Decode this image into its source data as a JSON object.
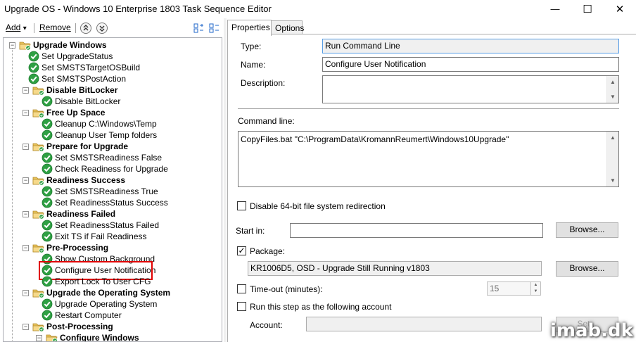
{
  "window": {
    "title": "Upgrade OS - Windows 10 Enterprise 1803 Task Sequence Editor",
    "minimize_glyph": "—",
    "maximize_glyph": "☐",
    "close_glyph": "✕"
  },
  "toolbar": {
    "add_label": "Add",
    "add_arrow": "▾",
    "remove_label": "Remove",
    "move_up_glyph": "⌃",
    "move_down_glyph": "⌄"
  },
  "tree": {
    "nodes": [
      {
        "label": "Upgrade Windows",
        "kind": "group",
        "level": 0
      },
      {
        "label": "Set UpgradeStatus",
        "kind": "step",
        "level": 1
      },
      {
        "label": "Set SMSTSTargetOSBuild",
        "kind": "step",
        "level": 1
      },
      {
        "label": "Set SMSTSPostAction",
        "kind": "step",
        "level": 1
      },
      {
        "label": "Disable BitLocker",
        "kind": "group",
        "level": 1
      },
      {
        "label": "Disable BitLocker",
        "kind": "step",
        "level": 2
      },
      {
        "label": "Free Up Space",
        "kind": "group",
        "level": 1
      },
      {
        "label": "Cleanup C:\\Windows\\Temp",
        "kind": "step",
        "level": 2
      },
      {
        "label": "Cleanup User Temp folders",
        "kind": "step",
        "level": 2
      },
      {
        "label": "Prepare for Upgrade",
        "kind": "group",
        "level": 1
      },
      {
        "label": "Set SMSTSReadiness False",
        "kind": "step",
        "level": 2
      },
      {
        "label": "Check Readiness for Upgrade",
        "kind": "step",
        "level": 2
      },
      {
        "label": "Readiness Success",
        "kind": "group",
        "level": 1
      },
      {
        "label": "Set SMSTSReadiness True",
        "kind": "step",
        "level": 2
      },
      {
        "label": "Set ReadinessStatus Success",
        "kind": "step",
        "level": 2
      },
      {
        "label": "Readiness Failed",
        "kind": "group",
        "level": 1
      },
      {
        "label": "Set ReadinessStatus Failed",
        "kind": "step",
        "level": 2
      },
      {
        "label": "Exit TS if Fail Readiness",
        "kind": "step",
        "level": 2
      },
      {
        "label": "Pre-Processing",
        "kind": "group",
        "level": 1
      },
      {
        "label": "Show Custom Background",
        "kind": "step",
        "level": 2
      },
      {
        "label": "Configure User Notification",
        "kind": "step",
        "level": 2,
        "selected": true
      },
      {
        "label": "Export Lock To User CFG",
        "kind": "step",
        "level": 2
      },
      {
        "label": "Upgrade the Operating System",
        "kind": "group",
        "level": 1
      },
      {
        "label": "Upgrade Operating System",
        "kind": "step",
        "level": 2
      },
      {
        "label": "Restart Computer",
        "kind": "step",
        "level": 2
      },
      {
        "label": "Post-Processing",
        "kind": "group",
        "level": 1
      },
      {
        "label": "Configure Windows",
        "kind": "group",
        "level": 2
      }
    ],
    "expander_glyph": "−"
  },
  "tabs": {
    "properties": "Properties",
    "options": "Options"
  },
  "properties": {
    "type_label": "Type:",
    "type_value": "Run Command Line",
    "name_label": "Name:",
    "name_value": "Configure User Notification",
    "description_label": "Description:",
    "description_value": "",
    "command_line_label": "Command line:",
    "command_line_value": "CopyFiles.bat \"C:\\ProgramData\\KromannReumert\\Windows10Upgrade\"",
    "disable_redirect_label": "Disable 64-bit file system redirection",
    "disable_redirect_checked": false,
    "start_in_label": "Start in:",
    "start_in_value": "",
    "browse_label": "Browse...",
    "package_label": "Package:",
    "package_checked": true,
    "check_glyph": "✓",
    "package_value": "KR1006D5, OSD - Upgrade Still Running v1803",
    "timeout_label": "Time-out (minutes):",
    "timeout_checked": false,
    "timeout_value": "15",
    "run_as_label": "Run this step as the following account",
    "run_as_checked": false,
    "account_label": "Account:",
    "account_value": "",
    "set_label": "Set..."
  },
  "watermark": "imab.dk",
  "colors": {
    "check_green": "#2ea043",
    "folder_yellow": "#e8c35c",
    "highlight_red": "#e00000"
  }
}
